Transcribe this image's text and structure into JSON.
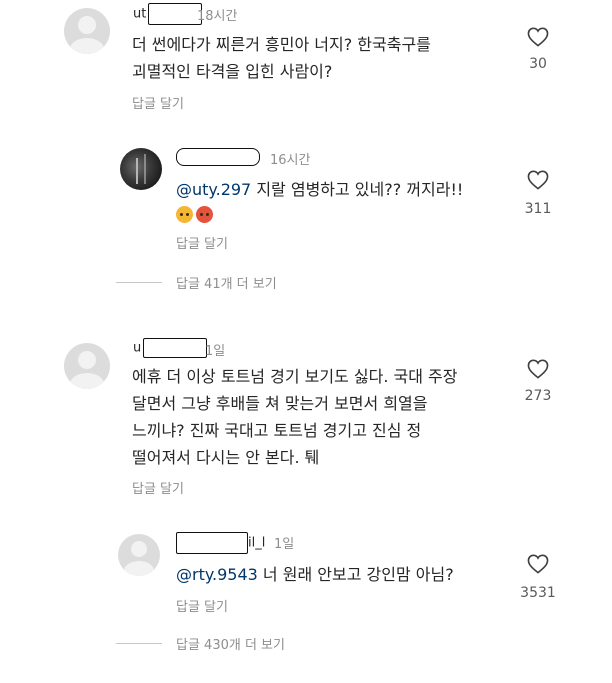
{
  "comments": [
    {
      "username_prefix": "ut",
      "time": "18시간",
      "text_line1": "더 썬에다가 찌른거 흥민아 너지? 한국축구를",
      "text_line2": "괴멸적인 타격을 입힌 사람이?",
      "reply_label": "답글 달기",
      "likes": "30"
    },
    {
      "username_prefix": "",
      "time": "16시간",
      "mention": "@uty.297",
      "text": " 지랄 염병하고 있네?? 꺼지라!!",
      "emojis": [
        "angry-face",
        "enraged-face"
      ],
      "reply_label": "답글 달기",
      "likes": "311"
    },
    {
      "more_replies": "답글 41개 더 보기"
    },
    {
      "username_prefix": "u",
      "time": "1일",
      "text_line1": "에휴 더 이상 토트넘 경기 보기도 싫다. 국대 주장",
      "text_line2": "달면서 그냥 후배들 쳐 맞는거 보면서 희열을",
      "text_line3": "느끼냐? 진짜 국대고 토트넘 경기고 진심 정",
      "text_line4": "떨어져서 다시는 안 본다. 퉤",
      "reply_label": "답글 달기",
      "likes": "273"
    },
    {
      "username_suffix": "il_l",
      "time": "1일",
      "mention": "@rty.9543",
      "text": " 너 원래 안보고 강인맘 아님?",
      "reply_label": "답글 달기",
      "likes": "3531"
    },
    {
      "more_replies": "답글 430개 더 보기"
    }
  ],
  "icons": {
    "like": "heart-outline-icon",
    "default_avatar": "default-avatar-icon"
  }
}
